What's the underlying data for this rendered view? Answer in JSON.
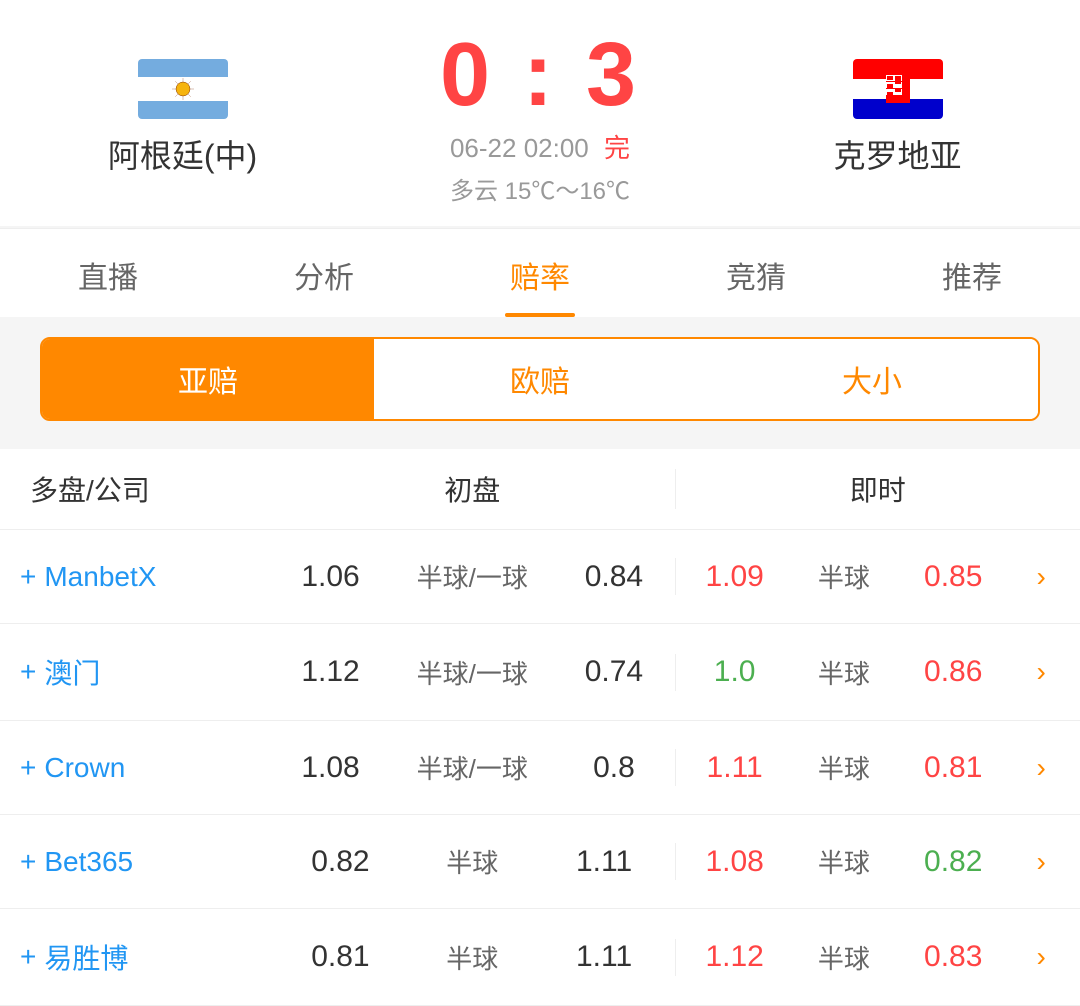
{
  "header": {
    "team_home": "阿根廷(中)",
    "team_away": "克罗地亚",
    "score": "0 : 3",
    "score_home": "0",
    "score_separator": ":",
    "score_away": "3",
    "match_time": "06-22 02:00",
    "match_status": "完",
    "weather": "多云  15℃～16℃"
  },
  "nav_tabs": [
    {
      "label": "直播",
      "active": false
    },
    {
      "label": "分析",
      "active": false
    },
    {
      "label": "赔率",
      "active": true
    },
    {
      "label": "竞猜",
      "active": false
    },
    {
      "label": "推荐",
      "active": false
    }
  ],
  "sub_tabs": [
    {
      "label": "亚赔",
      "active": true
    },
    {
      "label": "欧赔",
      "active": false
    },
    {
      "label": "大小",
      "active": false
    }
  ],
  "table": {
    "header": {
      "company_col": "多盘/公司",
      "initial_col": "初盘",
      "live_col": "即时"
    },
    "rows": [
      {
        "company": "ManbetX",
        "init_home": "1.06",
        "init_handicap": "半球/一球",
        "init_away": "0.84",
        "live_home": "1.09",
        "live_home_color": "red",
        "live_handicap": "半球",
        "live_away": "0.85",
        "live_away_color": "red"
      },
      {
        "company": "澳门",
        "init_home": "1.12",
        "init_handicap": "半球/一球",
        "init_away": "0.74",
        "live_home": "1.0",
        "live_home_color": "green",
        "live_handicap": "半球",
        "live_away": "0.86",
        "live_away_color": "red"
      },
      {
        "company": "Crown",
        "init_home": "1.08",
        "init_handicap": "半球/一球",
        "init_away": "0.8",
        "live_home": "1.11",
        "live_home_color": "red",
        "live_handicap": "半球",
        "live_away": "0.81",
        "live_away_color": "red"
      },
      {
        "company": "Bet365",
        "init_home": "0.82",
        "init_handicap": "半球",
        "init_away": "1.11",
        "live_home": "1.08",
        "live_home_color": "red",
        "live_handicap": "半球",
        "live_away": "0.82",
        "live_away_color": "green"
      },
      {
        "company": "易胜博",
        "init_home": "0.81",
        "init_handicap": "半球",
        "init_away": "1.11",
        "live_home": "1.12",
        "live_home_color": "red",
        "live_handicap": "半球",
        "live_away": "0.83",
        "live_away_color": "red"
      }
    ]
  }
}
